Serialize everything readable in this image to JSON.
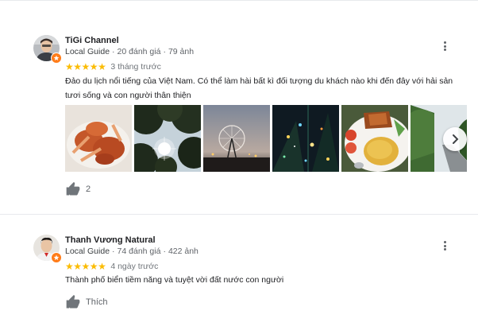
{
  "colors": {
    "star": "#fbbc04",
    "guide_badge": "#ff7c19",
    "text_secondary": "#5f6368"
  },
  "reviews": [
    {
      "author": "TiGi Channel",
      "guide": "Local Guide",
      "review_count": "20 đánh giá",
      "photo_count": "79 ảnh",
      "stars": 5,
      "date": "3 tháng trước",
      "text": "Đảo du lịch nổi tiếng của Việt Nam. Có thể làm hài bất kì đối tượng du khách nào khi đến đây với hải sản tươi sống và con người thân thiện",
      "photos": [
        "crab-dish-icon",
        "tree-canopy-icon",
        "ferris-wheel-icon",
        "night-lights-icon",
        "fried-rice-icon",
        "forest-road-icon"
      ],
      "likes": "2"
    },
    {
      "author": "Thanh Vương Natural",
      "guide": "Local Guide",
      "review_count": "74 đánh giá",
      "photo_count": "422 ảnh",
      "stars": 5,
      "date": "4 ngày trước",
      "text": "Thành phố biển tiềm năng và tuyệt vời đất nước con người",
      "likes": "Thích"
    }
  ]
}
